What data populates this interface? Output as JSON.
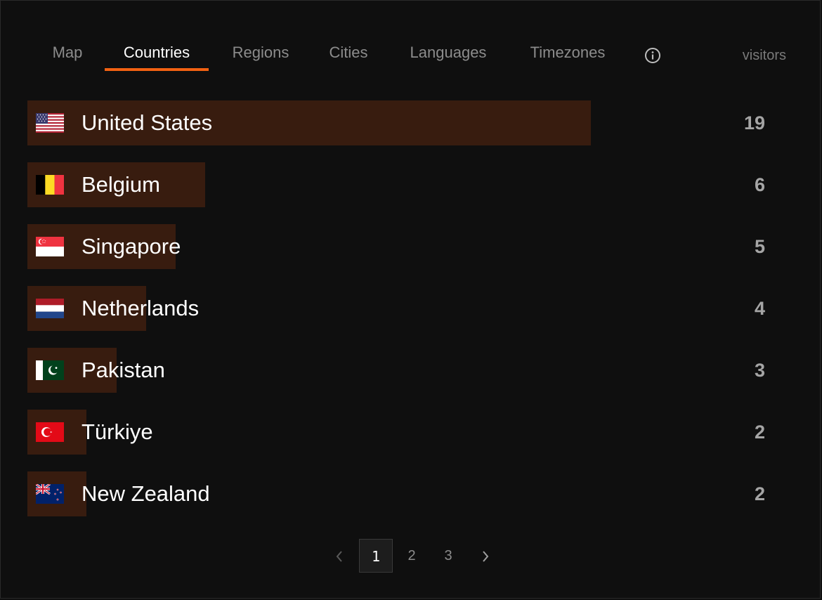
{
  "tabs": [
    {
      "label": "Map",
      "active": false
    },
    {
      "label": "Countries",
      "active": true
    },
    {
      "label": "Regions",
      "active": false
    },
    {
      "label": "Cities",
      "active": false
    },
    {
      "label": "Languages",
      "active": false
    },
    {
      "label": "Timezones",
      "active": false
    }
  ],
  "info_icon": "info-circle-icon",
  "column_label": "visitors",
  "accent_color": "#f26112",
  "bar_color": "#381c0f",
  "max_visitors": 19,
  "countries": [
    {
      "name": "United States",
      "visitors": "19",
      "flag": "flag-us-icon",
      "value": 19
    },
    {
      "name": "Belgium",
      "visitors": "6",
      "flag": "flag-be-icon",
      "value": 6
    },
    {
      "name": "Singapore",
      "visitors": "5",
      "flag": "flag-sg-icon",
      "value": 5
    },
    {
      "name": "Netherlands",
      "visitors": "4",
      "flag": "flag-nl-icon",
      "value": 4
    },
    {
      "name": "Pakistan",
      "visitors": "3",
      "flag": "flag-pk-icon",
      "value": 3
    },
    {
      "name": "Türkiye",
      "visitors": "2",
      "flag": "flag-tr-icon",
      "value": 2
    },
    {
      "name": "New Zealand",
      "visitors": "2",
      "flag": "flag-nz-icon",
      "value": 2
    }
  ],
  "pagination": {
    "pages": [
      "1",
      "2",
      "3"
    ],
    "current": "1",
    "prev_icon": "chevron-left-icon",
    "next_icon": "chevron-right-icon"
  }
}
